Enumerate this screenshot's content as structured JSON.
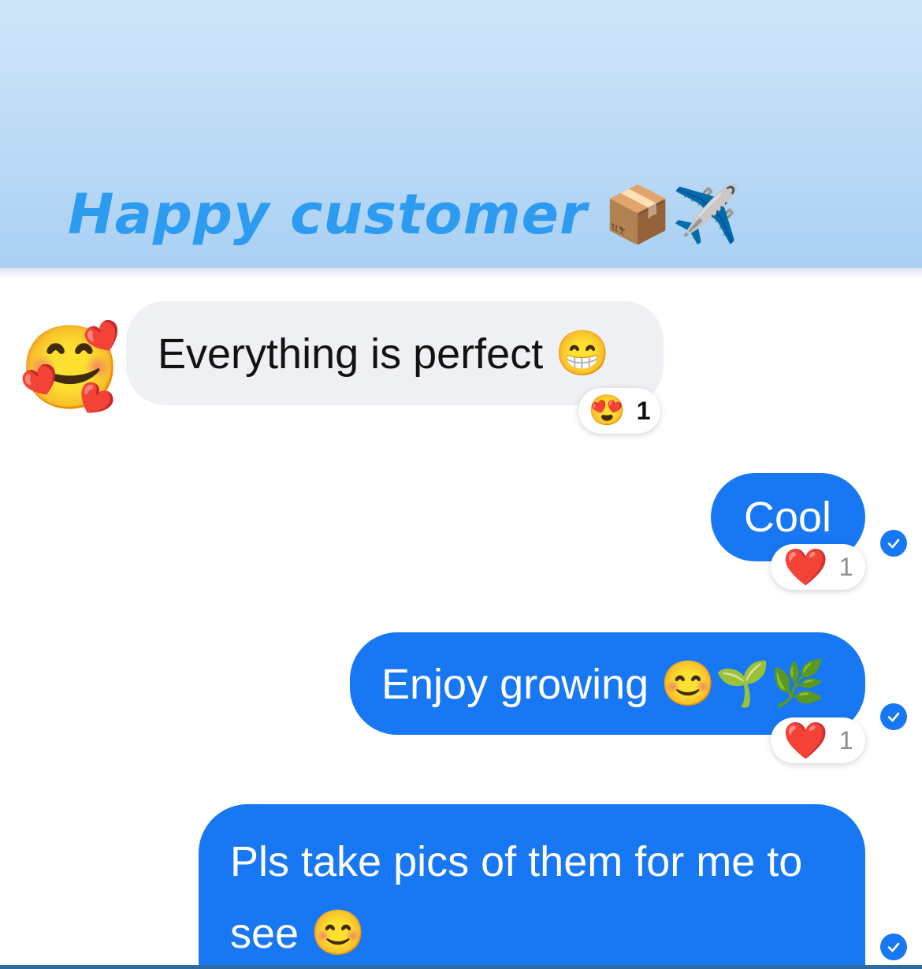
{
  "header": {
    "title": "Happy customer",
    "title_emojis": "📦✈️"
  },
  "messages": [
    {
      "direction": "incoming",
      "avatar": "🥰",
      "text": "Everything is perfect",
      "emoji": "😁",
      "reaction": {
        "emoji": "😍",
        "count": "1"
      }
    },
    {
      "direction": "outgoing",
      "text": "Cool",
      "reaction": {
        "emoji": "❤️",
        "count": "1"
      },
      "status": "sent-check-icon"
    },
    {
      "direction": "outgoing",
      "text": "Enjoy growing",
      "emoji": "😊🌱🌿",
      "reaction": {
        "emoji": "❤️",
        "count": "1"
      },
      "status": "sent-check-icon"
    },
    {
      "direction": "outgoing",
      "text": "Pls take pics of them for me to see",
      "emoji": "😊",
      "status": "sent-check-icon"
    }
  ],
  "colors": {
    "outgoing_bubble": "#1877f2",
    "incoming_bubble": "#eef0f3",
    "title": "#2d9cf0",
    "header_bg": "#bcdaf6"
  }
}
